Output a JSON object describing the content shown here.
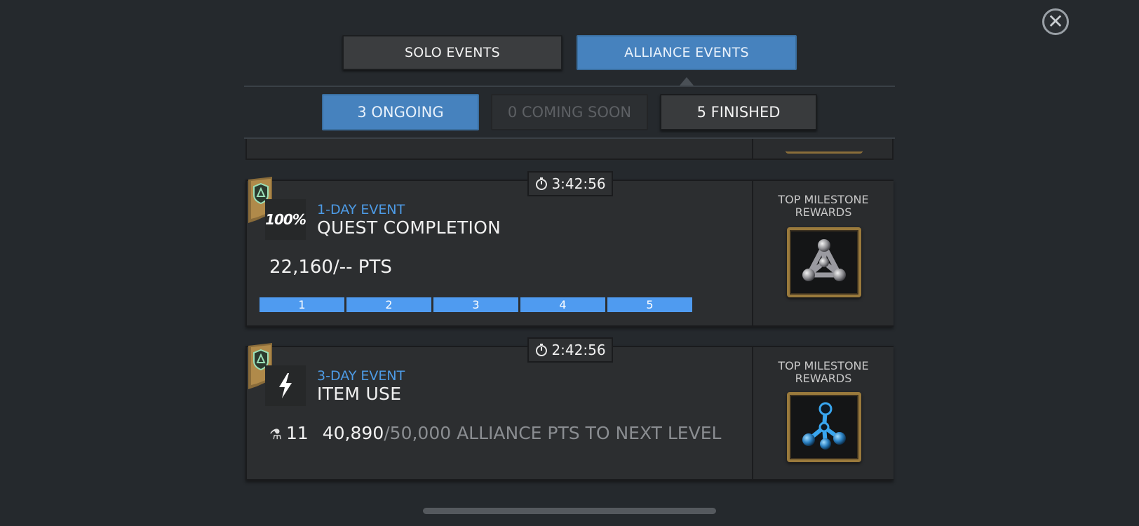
{
  "header": {
    "tabs": {
      "solo": "SOLO EVENTS",
      "alliance": "ALLIANCE EVENTS"
    },
    "subtabs": {
      "ongoing": "3 ONGOING",
      "coming_soon": "0 COMING SOON",
      "finished": "5 FINISHED"
    },
    "close_icon": "close-icon"
  },
  "events": [
    {
      "timer": "3:42:56",
      "type": "1-DAY EVENT",
      "name": "QUEST COMPLETION",
      "icon_text": "100%",
      "points": "22,160",
      "points_target": "/-- PTS",
      "milestones": [
        "1",
        "2",
        "3",
        "4",
        "5"
      ],
      "reward_label": "TOP MILESTONE REWARDS"
    },
    {
      "timer": "2:42:56",
      "type": "3-DAY EVENT",
      "name": "ITEM USE",
      "icon": "lightning-icon",
      "level": "11",
      "current": "40,890",
      "remaining": "/50,000 ALLIANCE PTS TO NEXT LEVEL",
      "reward_label": "TOP MILESTONE REWARDS"
    }
  ],
  "colors": {
    "accent_blue": "#4682be",
    "event_type_blue": "#4d9be6",
    "milestone_blue": "#4f9bf0",
    "reward_gold": "#9a7a3c"
  }
}
